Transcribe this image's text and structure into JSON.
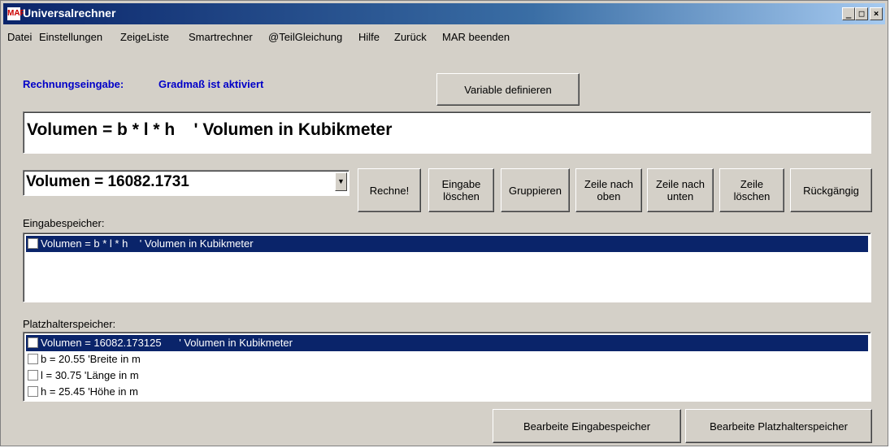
{
  "window": {
    "title": "Universalrechner",
    "icon": "MAR"
  },
  "caption_buttons": {
    "minimize": "_",
    "maximize": "□",
    "close": "×"
  },
  "menu": [
    "Datei",
    "Einstellungen",
    "ZeigeListe",
    "Smartrechner",
    "@TeilGleichung",
    "Hilfe",
    "Zurück",
    "MAR beenden"
  ],
  "input_label": "Rechnungseingabe:",
  "mode_label": "Gradmaß ist aktiviert",
  "define_variable_button": "Variable definieren",
  "formula_input": "Volumen = b * l * h    ' Volumen in Kubikmeter",
  "result_combo": "Volumen = 16082.1731",
  "buttons": {
    "rechne": "Rechne!",
    "eingabe_loeschen": "Eingabe\nlöschen",
    "gruppieren": "Gruppieren",
    "zeile_oben": "Zeile nach\noben",
    "zeile_unten": "Zeile nach\nunten",
    "zeile_loeschen": "Zeile\nlöschen",
    "rueckgaengig": "Rückgängig"
  },
  "eingabespeicher_label": "Eingabespeicher:",
  "eingabespeicher": [
    {
      "text": "Volumen = b * l * h    ' Volumen in Kubikmeter",
      "selected": true
    }
  ],
  "platzhalterspeicher_label": "Platzhalterspeicher:",
  "platzhalterspeicher": [
    {
      "text": "Volumen = 16082.173125      ' Volumen in Kubikmeter",
      "selected": true
    },
    {
      "text": "b = 20.55 'Breite in m",
      "selected": false
    },
    {
      "text": "l = 30.75 'Länge in m",
      "selected": false
    },
    {
      "text": "h = 25.45 'Höhe in m",
      "selected": false
    }
  ],
  "bottom_buttons": {
    "edit_input": "Bearbeite Eingabespeicher",
    "edit_placeholder": "Bearbeite Platzhalterspeicher"
  },
  "colors": {
    "title_start": "#0a246a",
    "title_end": "#a6caf0",
    "selection": "#0a246a",
    "label_blue": "#0000c8",
    "face": "#d4d0c8"
  }
}
